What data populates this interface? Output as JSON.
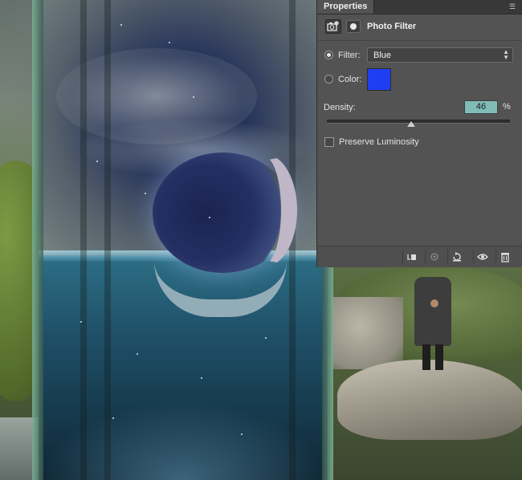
{
  "panel": {
    "tab_label": "Properties",
    "panel_menu_icon": "panel-menu-icon",
    "adjustment_icon": "photo-filter-adjustment-icon",
    "mask_icon": "layer-mask-icon",
    "title": "Photo Filter",
    "filter": {
      "label": "Filter:",
      "selected": true,
      "value": "Blue"
    },
    "color": {
      "label": "Color:",
      "selected": false,
      "swatch": "#1f3ef4"
    },
    "density": {
      "label": "Density:",
      "value": "46",
      "unit": "%",
      "slider_value": 46
    },
    "preserve_luminosity": {
      "label": "Preserve Luminosity",
      "checked": false
    },
    "bottom_buttons": [
      "clip-to-layer-icon",
      "view-previous-state-icon",
      "reset-icon",
      "visibility-eye-icon",
      "trash-icon"
    ]
  },
  "colors": {
    "panel_bg": "#535353",
    "tab_bar": "#383838",
    "density_field": "#7fbdb6"
  }
}
